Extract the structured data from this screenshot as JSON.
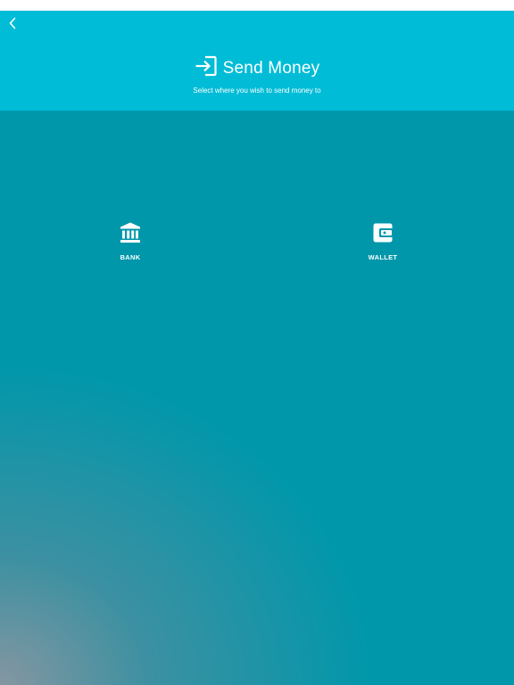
{
  "header": {
    "title": "Send Money",
    "subtitle": "Select where you wish to send money to",
    "back_icon": "chevron-left-icon",
    "title_icon": "login-arrow-icon",
    "background": "#00bcd7"
  },
  "content": {
    "background": "#0097ab",
    "options": [
      {
        "label": "BANK",
        "icon": "bank-icon"
      },
      {
        "label": "WALLET",
        "icon": "wallet-icon"
      }
    ]
  }
}
